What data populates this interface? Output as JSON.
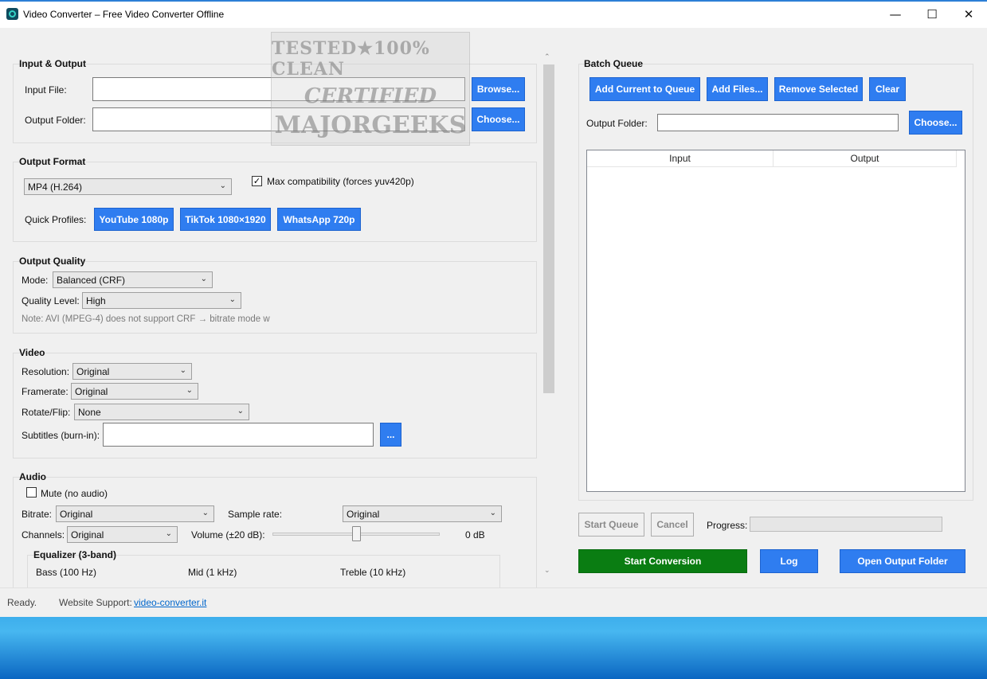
{
  "window": {
    "title": "Video Converter – Free Video Converter Offline"
  },
  "titlebar_buttons": {
    "minimize": "—",
    "maximize": "☐",
    "close": "✕"
  },
  "watermark": {
    "line1": "TESTED★100% CLEAN",
    "line2": "CERTIFIED",
    "line3": "MAJORGEEKS"
  },
  "io": {
    "title": "Input & Output",
    "input_label": "Input File:",
    "input_value": "",
    "browse": "Browse...",
    "output_label": "Output Folder:",
    "output_value": "",
    "choose": "Choose..."
  },
  "format": {
    "title": "Output Format",
    "selected": "MP4 (H.264)",
    "max_compat_label": "Max compatibility (forces yuv420p)",
    "max_compat_checked": true,
    "quick_profiles_label": "Quick Profiles:",
    "profiles": [
      "YouTube 1080p",
      "TikTok 1080×1920",
      "WhatsApp 720p"
    ]
  },
  "quality": {
    "title": "Output Quality",
    "mode_label": "Mode:",
    "mode": "Balanced (CRF)",
    "level_label": "Quality Level:",
    "level": "High",
    "note": "Note: AVI (MPEG-4) does not support CRF → bitrate mode w"
  },
  "video": {
    "title": "Video",
    "resolution_label": "Resolution:",
    "resolution": "Original",
    "framerate_label": "Framerate:",
    "framerate": "Original",
    "rotate_label": "Rotate/Flip:",
    "rotate": "None",
    "subtitles_label": "Subtitles (burn-in):",
    "subtitles_value": "",
    "subtitles_btn": "..."
  },
  "audio": {
    "title": "Audio",
    "mute_label": "Mute (no audio)",
    "mute_checked": false,
    "bitrate_label": "Bitrate:",
    "bitrate": "Original",
    "sample_rate_label": "Sample rate:",
    "sample_rate": "Original",
    "channels_label": "Channels:",
    "channels": "Original",
    "volume_label": "Volume (±20 dB):",
    "volume_value": "0 dB",
    "volume_fraction": 0.5,
    "eq_title": "Equalizer (3-band)",
    "eq_bass": "Bass (100 Hz)",
    "eq_mid": "Mid (1 kHz)",
    "eq_treble": "Treble (10 kHz)"
  },
  "batch": {
    "title": "Batch Queue",
    "add_current": "Add Current to Queue",
    "add_files": "Add Files...",
    "remove_selected": "Remove Selected",
    "clear": "Clear",
    "output_label": "Output Folder:",
    "output_value": "",
    "choose": "Choose...",
    "columns": [
      "Input",
      "Output"
    ],
    "rows": []
  },
  "controls": {
    "start_queue": "Start Queue",
    "cancel": "Cancel",
    "progress_label": "Progress:",
    "progress": 0,
    "start_conversion": "Start Conversion",
    "log": "Log",
    "open_output": "Open Output Folder"
  },
  "status": {
    "text": "Ready.",
    "support_label": "Website Support:",
    "support_link": "video-converter.it"
  },
  "colors": {
    "accent": "#2f7df0",
    "start": "#0a7d12"
  }
}
